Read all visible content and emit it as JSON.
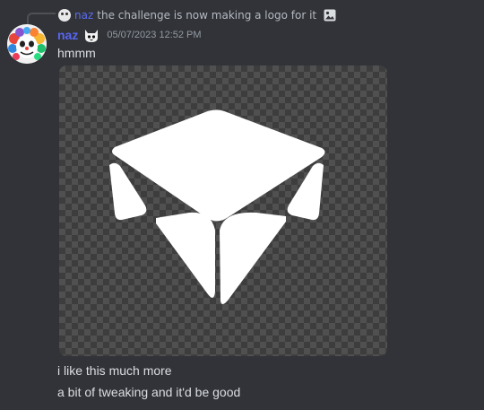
{
  "reply": {
    "username": "naz",
    "text": "the challenge is now making a logo for it",
    "attachment_icon": "image-icon"
  },
  "message": {
    "username": "naz",
    "timestamp": "05/07/2023 12:52 PM",
    "lines": [
      "hmmm",
      "i like this much more",
      "a bit of tweaking and it'd be good"
    ],
    "username_color": "#5865f2"
  },
  "attachment": {
    "type": "image",
    "description_icon": "logo-image"
  }
}
